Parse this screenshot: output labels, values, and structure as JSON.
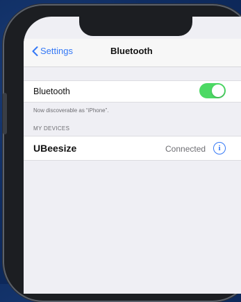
{
  "nav": {
    "back_label": "Settings",
    "title": "Bluetooth"
  },
  "bluetooth": {
    "label": "Bluetooth",
    "enabled": true,
    "discoverable_text": "Now discoverable as “iPhone”."
  },
  "devices": {
    "section_header": "MY DEVICES",
    "items": [
      {
        "name": "UBeesize",
        "status": "Connected",
        "info_glyph": "i"
      }
    ]
  },
  "colors": {
    "accent": "#3478f6",
    "toggle_on": "#4cd964",
    "background": "#0f2d62"
  },
  "icons": [
    "chevron-left-icon",
    "info-icon"
  ]
}
